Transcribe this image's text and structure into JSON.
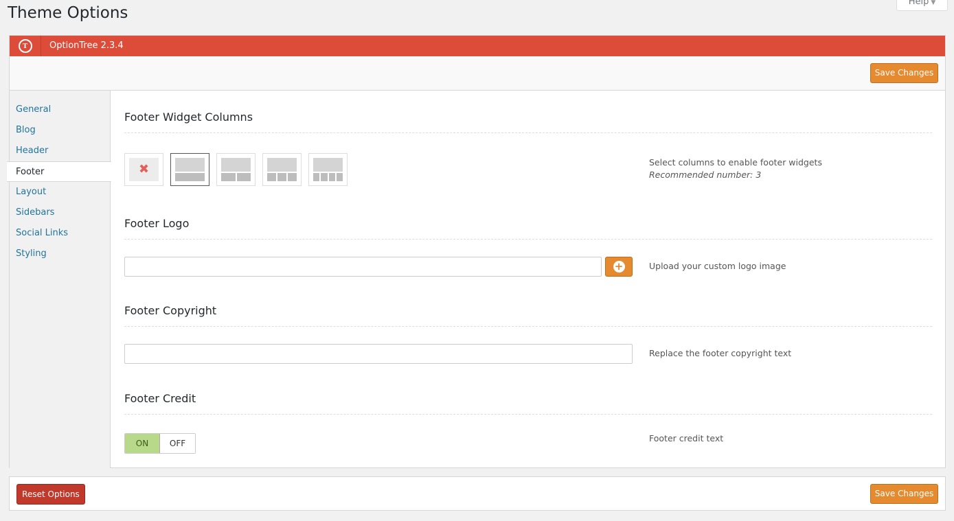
{
  "page": {
    "title": "Theme Options",
    "help_label": "Help"
  },
  "header": {
    "logo_letter": "T",
    "version": "OptionTree 2.3.4"
  },
  "toolbar": {
    "save_label": "Save Changes"
  },
  "sidebar": {
    "items": [
      {
        "label": "General"
      },
      {
        "label": "Blog"
      },
      {
        "label": "Header"
      },
      {
        "label": "Footer",
        "active": true
      },
      {
        "label": "Layout"
      },
      {
        "label": "Sidebars"
      },
      {
        "label": "Social Links"
      },
      {
        "label": "Styling"
      }
    ]
  },
  "sections": {
    "widget_columns": {
      "title": "Footer Widget Columns",
      "description": "Select columns to enable footer widgets",
      "recommended": "Recommended number: 3",
      "options": [
        {
          "columns": 0,
          "icon": "x-icon"
        },
        {
          "columns": 1,
          "selected": true
        },
        {
          "columns": 2
        },
        {
          "columns": 3
        },
        {
          "columns": 4
        }
      ]
    },
    "logo": {
      "title": "Footer Logo",
      "value": "",
      "description": "Upload your custom logo image",
      "upload_icon": "plus-circle-icon"
    },
    "copyright": {
      "title": "Footer Copyright",
      "value": "",
      "description": "Replace the footer copyright text"
    },
    "credit": {
      "title": "Footer Credit",
      "on_label": "ON",
      "off_label": "OFF",
      "state": "ON",
      "description": "Footer credit text"
    }
  },
  "footer": {
    "reset_label": "Reset Options",
    "save_label": "Save Changes"
  },
  "colors": {
    "brand_red": "#dd4b39",
    "accent_orange": "#e58a2f",
    "reset_red": "#c0392b",
    "toggle_on": "#b8d98a",
    "link_blue": "#21759b"
  }
}
